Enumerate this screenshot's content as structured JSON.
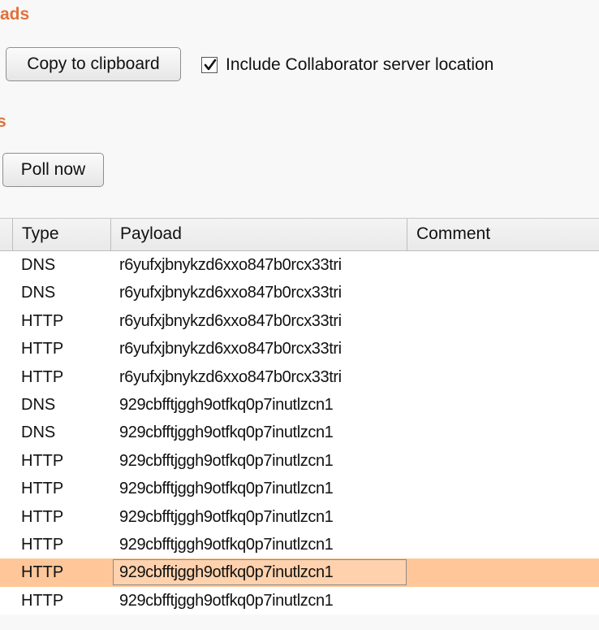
{
  "headings": {
    "payloads_partial": "ads",
    "interactions_partial": "s"
  },
  "payloads_section": {
    "copy_button": "Copy to clipboard",
    "include_location": {
      "checked": true,
      "label": "Include Collaborator server location"
    }
  },
  "interactions_section": {
    "poll_button": "Poll now"
  },
  "table": {
    "columns": [
      "Type",
      "Payload",
      "Comment"
    ],
    "selected_row": 11,
    "rows": [
      {
        "type": "DNS",
        "payload": "r6yufxjbnykzd6xxo847b0rcx33tri",
        "comment": ""
      },
      {
        "type": "DNS",
        "payload": "r6yufxjbnykzd6xxo847b0rcx33tri",
        "comment": ""
      },
      {
        "type": "HTTP",
        "payload": "r6yufxjbnykzd6xxo847b0rcx33tri",
        "comment": ""
      },
      {
        "type": "HTTP",
        "payload": "r6yufxjbnykzd6xxo847b0rcx33tri",
        "comment": ""
      },
      {
        "type": "HTTP",
        "payload": "r6yufxjbnykzd6xxo847b0rcx33tri",
        "comment": ""
      },
      {
        "type": "DNS",
        "payload": "929cbfftjggh9otfkq0p7inutlzcn1",
        "comment": ""
      },
      {
        "type": "DNS",
        "payload": "929cbfftjggh9otfkq0p7inutlzcn1",
        "comment": ""
      },
      {
        "type": "HTTP",
        "payload": "929cbfftjggh9otfkq0p7inutlzcn1",
        "comment": ""
      },
      {
        "type": "HTTP",
        "payload": "929cbfftjggh9otfkq0p7inutlzcn1",
        "comment": ""
      },
      {
        "type": "HTTP",
        "payload": "929cbfftjggh9otfkq0p7inutlzcn1",
        "comment": ""
      },
      {
        "type": "HTTP",
        "payload": "929cbfftjggh9otfkq0p7inutlzcn1",
        "comment": ""
      },
      {
        "type": "HTTP",
        "payload": "929cbfftjggh9otfkq0p7inutlzcn1",
        "comment": ""
      },
      {
        "type": "HTTP",
        "payload": "929cbfftjggh9otfkq0p7inutlzcn1",
        "comment": ""
      }
    ]
  },
  "colors": {
    "heading": "#e2703a",
    "selected_row": "#ffc799"
  }
}
